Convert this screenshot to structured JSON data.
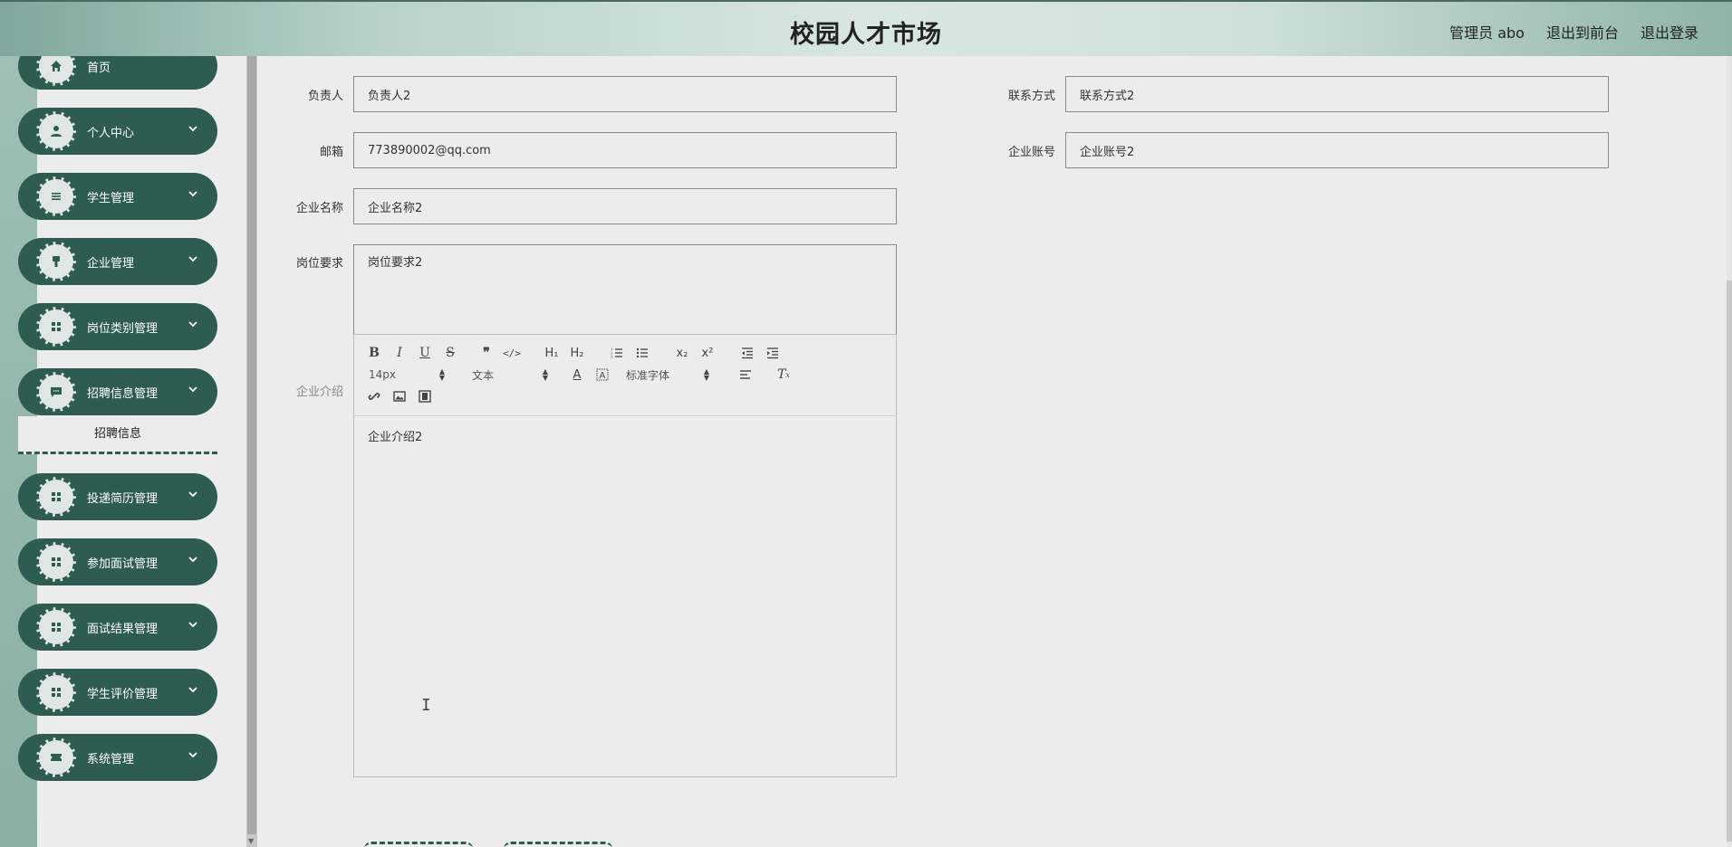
{
  "header": {
    "title": "校园人才市场",
    "admin_label": "管理员 abo",
    "back_to_front": "退出到前台",
    "logout": "退出登录"
  },
  "sidebar": {
    "items": [
      {
        "label": "首页",
        "icon": "home-icon"
      },
      {
        "label": "个人中心",
        "icon": "user-icon"
      },
      {
        "label": "学生管理",
        "icon": "list-icon"
      },
      {
        "label": "企业管理",
        "icon": "brush-icon"
      },
      {
        "label": "岗位类别管理",
        "icon": "grid-icon"
      },
      {
        "label": "招聘信息管理",
        "icon": "chat-icon"
      },
      {
        "label": "投递简历管理",
        "icon": "grid-icon"
      },
      {
        "label": "参加面试管理",
        "icon": "grid-icon"
      },
      {
        "label": "面试结果管理",
        "icon": "grid-icon"
      },
      {
        "label": "学生评价管理",
        "icon": "grid-icon"
      },
      {
        "label": "系统管理",
        "icon": "ticket-icon"
      }
    ],
    "sub_item": "招聘信息"
  },
  "form": {
    "responsible_label": "负责人",
    "responsible_value": "负责人2",
    "contact_label": "联系方式",
    "contact_value": "联系方式2",
    "email_label": "邮箱",
    "email_value": "773890002@qq.com",
    "account_label": "企业账号",
    "account_value": "企业账号2",
    "company_label": "企业名称",
    "company_value": "企业名称2",
    "requirement_label": "岗位要求",
    "requirement_value": "岗位要求2",
    "intro_label": "企业介绍",
    "intro_value": "企业介绍2"
  },
  "editor": {
    "font_size": "14px",
    "text_style": "文本",
    "font_family": "标准字体"
  }
}
